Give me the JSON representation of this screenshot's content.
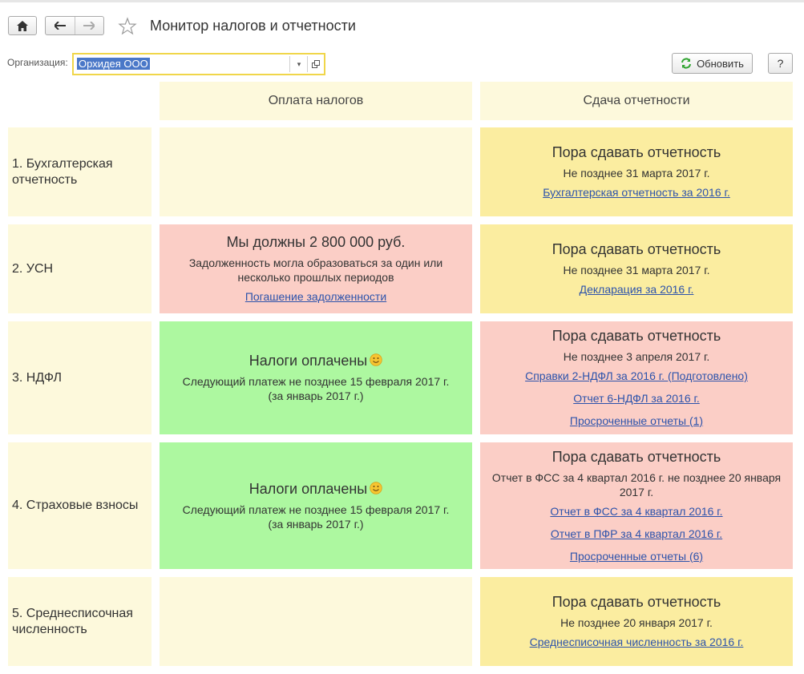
{
  "window": {
    "title": "Монитор налогов и отчетности"
  },
  "filter": {
    "org_label": "Организация:",
    "org_value": "Орхидея ООО"
  },
  "toolbar": {
    "refresh_label": "Обновить",
    "help_label": "?"
  },
  "columns": {
    "taxes": "Оплата налогов",
    "reports": "Сдача отчетности"
  },
  "rows": [
    {
      "label": "1. Бухгалтерская отчетность",
      "taxes": null,
      "reports": {
        "status": "Пора сдавать отчетность",
        "deadline": "Не позднее 31 марта 2017 г.",
        "links": [
          "Бухгалтерская отчетность за 2016 г."
        ]
      }
    },
    {
      "label": "2. УСН",
      "taxes": {
        "status": "Мы должны 2 800 000 руб.",
        "note": "Задолженность могла образоваться за один или несколько прошлых периодов",
        "link": "Погашение задолженности"
      },
      "reports": {
        "status": "Пора сдавать отчетность",
        "deadline": "Не позднее 31 марта 2017 г.",
        "links": [
          "Декларация за 2016 г."
        ]
      }
    },
    {
      "label": "3. НДФЛ",
      "taxes": {
        "status": "Налоги оплачены",
        "note": "Следующий платеж не позднее 15 февраля 2017 г. (за январь 2017 г.)"
      },
      "reports": {
        "status": "Пора сдавать отчетность",
        "deadline": "Не позднее 3 апреля 2017 г.",
        "links": [
          "Справки 2-НДФЛ за 2016 г. (Подготовлено)",
          "Отчет 6-НДФЛ за 2016 г.",
          "Просроченные отчеты (1)"
        ]
      }
    },
    {
      "label": "4. Страховые взносы",
      "taxes": {
        "status": "Налоги оплачены",
        "note": "Следующий платеж не позднее 15 февраля 2017 г. (за январь 2017 г.)"
      },
      "reports": {
        "status": "Пора сдавать отчетность",
        "deadline": "Отчет в ФСС за 4 квартал 2016 г. не позднее 20 января 2017 г.",
        "links": [
          "Отчет в ФСС за 4 квартал 2016 г.",
          "Отчет в ПФР за 4 квартал 2016 г.",
          "Просроченные отчеты (6)"
        ]
      }
    },
    {
      "label": "5. Среднесписочная численность",
      "taxes": null,
      "reports": {
        "status": "Пора сдавать отчетность",
        "deadline": "Не позднее 20 января 2017 г.",
        "links": [
          "Среднесписочная численность за 2016 г."
        ]
      }
    }
  ],
  "colors": {
    "cream": "#fdf9dc",
    "yellow": "#fbeda0",
    "pink": "#fbcec6",
    "green": "#adf8a0",
    "link": "#2d53ab",
    "focus": "#f0d64a"
  }
}
